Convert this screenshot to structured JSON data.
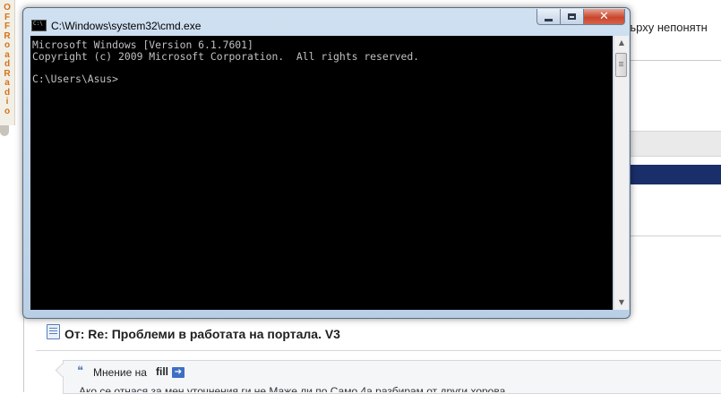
{
  "background_page": {
    "side_radio_text": "OFFRoadRadio",
    "top_text": "ърху непонятн",
    "post_title": "От: Re: Проблеми в работата на портала. V3",
    "quote_label": "Мнение на",
    "quote_author": "fill",
    "quote_text": "Ако се отнася за мен уточнения ги не Маже ли по Само 4а разбирам от други хорова"
  },
  "cmd": {
    "title": "C:\\Windows\\system32\\cmd.exe",
    "buttons": {
      "minimize": "minimize",
      "maximize": "maximize",
      "close": "close"
    },
    "console_text": "Microsoft Windows [Version 6.1.7601]\nCopyright (c) 2009 Microsoft Corporation.  All rights reserved.\n\nC:\\Users\\Asus>"
  },
  "colors": {
    "console_bg": "#000000",
    "console_fg": "#c0c0c0",
    "navy_band": "#1a2e6a",
    "radio_orange": "#d4731b"
  }
}
